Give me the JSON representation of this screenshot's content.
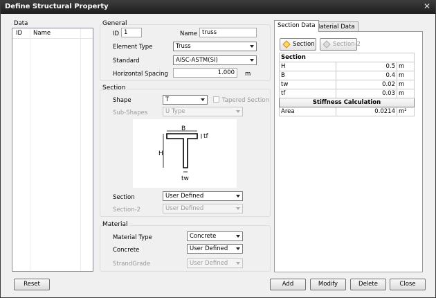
{
  "window": {
    "title": "Define Structural Property",
    "close_glyph": "✕"
  },
  "data_panel": {
    "title": "Data",
    "columns": [
      "ID",
      "Name"
    ]
  },
  "general": {
    "title": "General",
    "id_label": "ID",
    "id_value": "1",
    "name_label": "Name",
    "name_value": "truss",
    "element_type_label": "Element Type",
    "element_type_value": "Truss",
    "standard_label": "Standard",
    "standard_value": "AISC-ASTM(SI)",
    "hspacing_label": "Horizontal Spacing",
    "hspacing_value": "1.000",
    "hspacing_unit": "m"
  },
  "section": {
    "title": "Section",
    "shape_label": "Shape",
    "shape_value": "T",
    "tapered_label": "Tapered Section",
    "subshapes_label": "Sub-Shapes",
    "subshapes_value": "U Type",
    "section_label": "Section",
    "section_value": "User Defined",
    "section2_label": "Section-2",
    "section2_value": "User Defined",
    "diagram_labels": {
      "b": "B",
      "tf": "tf",
      "h": "H",
      "tw": "tw"
    }
  },
  "material": {
    "title": "Material",
    "type_label": "Material Type",
    "type_value": "Concrete",
    "concrete_label": "Concrete",
    "concrete_value": "User Defined",
    "strand_label": "StrandGrade",
    "strand_value": "User Defined"
  },
  "tabs": {
    "section_data": "Section Data",
    "material_data": "Material Data"
  },
  "section_buttons": {
    "section": "Section",
    "section2": "Section-2"
  },
  "section_table": {
    "header": "Section",
    "rows": [
      {
        "name": "H",
        "value": "0.5",
        "unit": "m"
      },
      {
        "name": "B",
        "value": "0.4",
        "unit": "m"
      },
      {
        "name": "tw",
        "value": "0.02",
        "unit": "m"
      },
      {
        "name": "tf",
        "value": "0.03",
        "unit": "m"
      }
    ],
    "stiffness_header": "Stiffness Calculation",
    "area": {
      "name": "Area",
      "value": "0.0214",
      "unit": "m²"
    }
  },
  "buttons": {
    "reset": "Reset",
    "add": "Add",
    "modify": "Modify",
    "delete": "Delete",
    "close": "Close"
  }
}
